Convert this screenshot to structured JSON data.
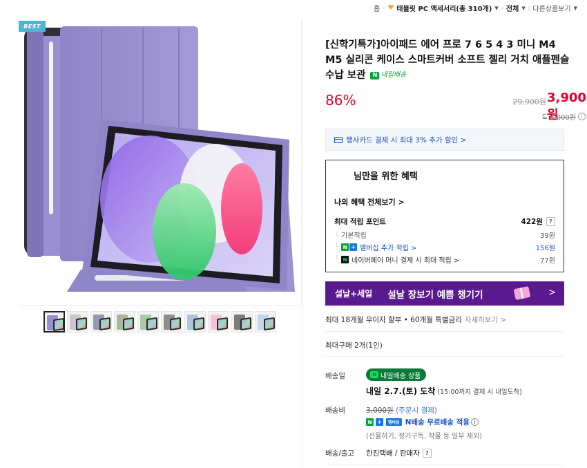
{
  "breadcrumb": {
    "home": "홈",
    "category": "태블릿 PC 액세서리(총 310개)",
    "filter": "전체",
    "other": "다른상품보기"
  },
  "gallery": {
    "badge": "BEST",
    "thumbnail_colors": [
      "#9a8fd0",
      "#c9c9c9",
      "#8f9bae",
      "#a9b89c",
      "#a7cba3",
      "#8d8d8d",
      "#a9c8e0",
      "#f2c4d4",
      "#7c7c7c",
      "#c3d8ea"
    ]
  },
  "product": {
    "title": "[신학기특가]아이패드 에어 프로 7 6 5 4 3 미니 M4 M5 실리콘 케이스 스마트커버 소프트 젤리 거치 애플펜슬 수납 보관",
    "delivery_tag_logo": "N",
    "delivery_tag": "내일배송",
    "discount": "86%",
    "original_price": "29,900원",
    "sale_price": "3,900원",
    "sub_price": "3,000원"
  },
  "card_banner": {
    "text": "행사카드 결제 시 최대 3% 추가 할인 >"
  },
  "benefits": {
    "title": "님만을 위한 혜택",
    "my_benefits": "나의 혜택 전체보기 >",
    "max_points_label": "최대 적립 포인트",
    "max_points_value": "422원",
    "question": "?",
    "basic_label": "기본적립",
    "basic_value": "39원",
    "membership_label": "멤버십 추가 적립 >",
    "membership_value": "156원",
    "naverpay_label": "네이버페이 머니 결제 시 최대 적립 >",
    "naverpay_value": "77원"
  },
  "promo": {
    "left": "설날+세일",
    "right": "설날 장보기 예쁨 챙기기",
    "arrow": ">"
  },
  "installment": {
    "text": "최대 18개월 무이자 할부 • 60개월 특별금리",
    "more": "자세히보기 >"
  },
  "max_purchase": "최대구매 2개(1인)",
  "shipping": {
    "date_label": "배송일",
    "badge": "내일배송 상품",
    "date": "내일 2.7.(토) 도착",
    "date_note": "(15:00까지 결제 시 내일도착)",
    "fee_label": "배송비",
    "fee_original": "3,000원",
    "fee_condition": "(주문시 결제)",
    "membership_badge": "멤버십",
    "free": "N배송 무료배송 적용",
    "note": "(선물하기, 정기구독, 작물 등 일부 제외)",
    "courier_label": "배송/출고",
    "courier": "한진택배 / 판매자"
  }
}
